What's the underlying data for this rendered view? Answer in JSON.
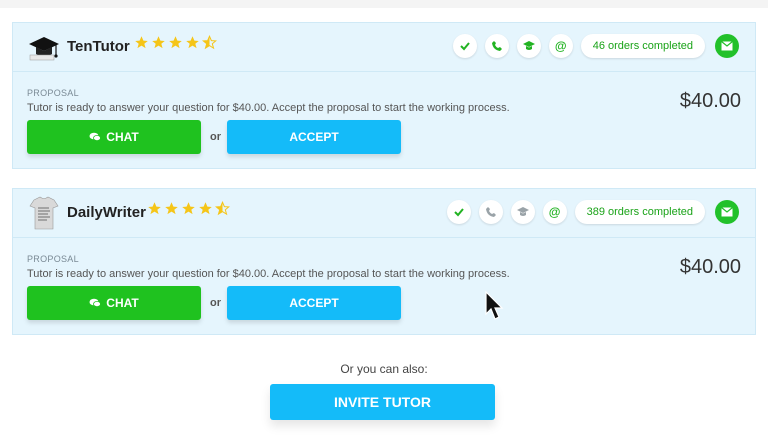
{
  "tutors": [
    {
      "name": "TenTutor",
      "rating": 4.5,
      "verified_icons": [
        "check-icon",
        "phone-icon",
        "graduation-cap-icon",
        "at-icon"
      ],
      "orders": "46 orders completed",
      "proposal_label": "PROPOSAL",
      "proposal_text": "Tutor is ready to answer your question for $40.00. Accept the proposal to start the working process.",
      "price": "$40.00",
      "chat_label": "CHAT",
      "or_label": "or",
      "accept_label": "ACCEPT"
    },
    {
      "name": "DailyWriter",
      "rating": 4.5,
      "verified_icons": [
        "check-icon",
        "phone-icon",
        "graduation-cap-icon",
        "at-icon"
      ],
      "orders": "389 orders completed",
      "proposal_label": "PROPOSAL",
      "proposal_text": "Tutor is ready to answer your question for $40.00. Accept the proposal to start the working process.",
      "price": "$40.00",
      "chat_label": "CHAT",
      "or_label": "or",
      "accept_label": "ACCEPT"
    }
  ],
  "footer": {
    "also_text": "Or you can also:",
    "invite_label": "INVITE TUTOR"
  },
  "colors": {
    "card_bg": "#e5f5fd",
    "chat_green": "#1fc21f",
    "accept_blue": "#14bbf9",
    "star_yellow": "#f5c518",
    "orders_green": "#1aa318"
  }
}
